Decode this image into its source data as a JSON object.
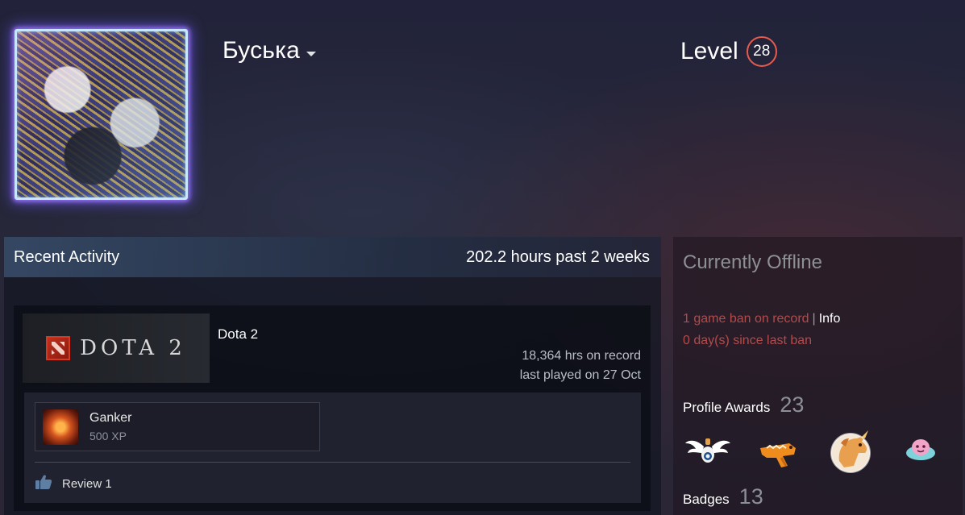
{
  "profile": {
    "persona_name": "Буська",
    "level_label": "Level",
    "level_value": "28",
    "accent_color": "#e55b4d"
  },
  "recent_activity": {
    "title": "Recent Activity",
    "summary": "202.2 hours past 2 weeks",
    "games": [
      {
        "name": "Dota 2",
        "capsule_wordmark": "DOTA 2",
        "hours_on_record": "18,364 hrs on record",
        "last_played": "last played on 27 Oct",
        "achievement": {
          "title": "Ganker",
          "xp": "500 XP"
        },
        "review_label": "Review 1"
      }
    ]
  },
  "sidebar": {
    "status": "Currently Offline",
    "ban_text": "1 game ban on record",
    "ban_separator": "|",
    "ban_info_link": "Info",
    "ban_days": "0 day(s) since last ban",
    "ban_color": "#b44b4b",
    "profile_awards": {
      "label": "Profile Awards",
      "count": "23"
    },
    "award_icons": [
      "winged-steam-award-icon",
      "orange-dinosaur-award-icon",
      "unicorn-award-icon",
      "pink-blob-award-icon"
    ],
    "badges": {
      "label": "Badges",
      "count": "13"
    }
  }
}
